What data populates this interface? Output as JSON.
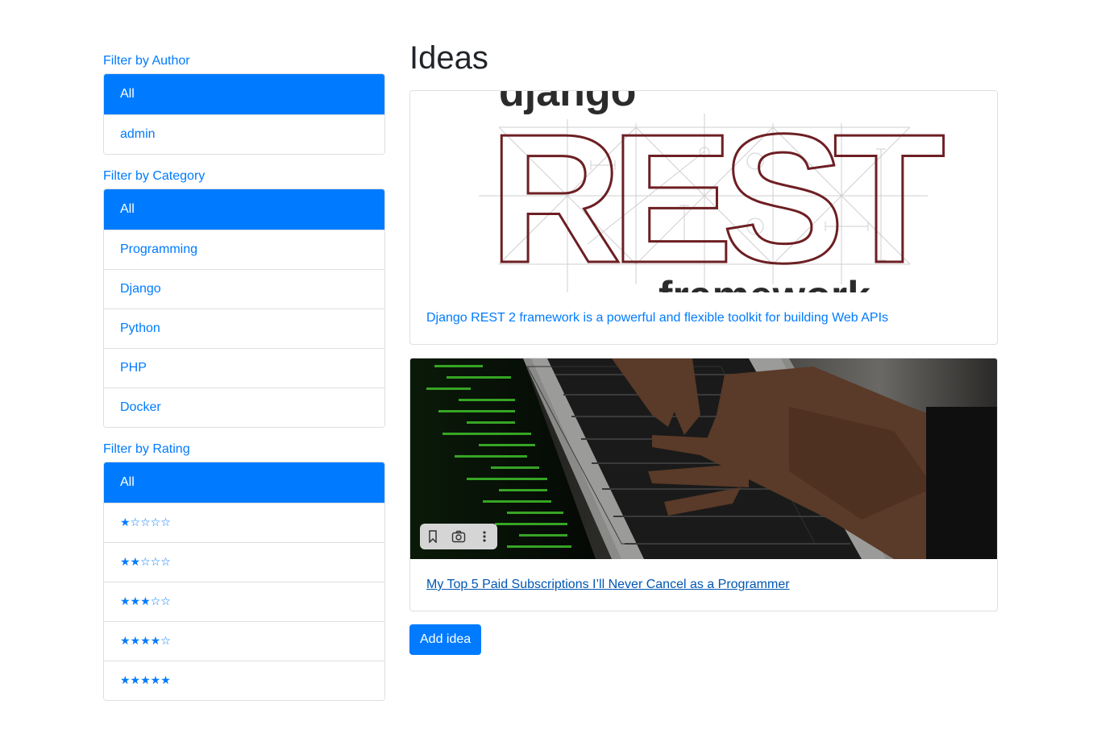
{
  "sidebar": {
    "author": {
      "title": "Filter by Author",
      "items": [
        "All",
        "admin"
      ]
    },
    "category": {
      "title": "Filter by Category",
      "items": [
        "All",
        "Programming",
        "Django",
        "Python",
        "PHP",
        "Docker"
      ]
    },
    "rating": {
      "title": "Filter by Rating",
      "items": [
        "All",
        "★☆☆☆☆",
        "★★☆☆☆",
        "★★★☆☆",
        "★★★★☆",
        "★★★★★"
      ]
    }
  },
  "main": {
    "title": "Ideas",
    "ideas": [
      {
        "image_text_top": "django",
        "image_text_main": "REST",
        "image_text_bottom": "framework",
        "link": "Django REST 2 framework is a powerful and flexible toolkit for building Web APIs"
      },
      {
        "link": "My Top 5 Paid Subscriptions I’ll Never Cancel as a Programmer"
      }
    ],
    "add_button": "Add idea"
  },
  "colors": {
    "primary": "#007bff",
    "link_hover": "#0056b3",
    "rest_logo": "#6d1f23"
  }
}
